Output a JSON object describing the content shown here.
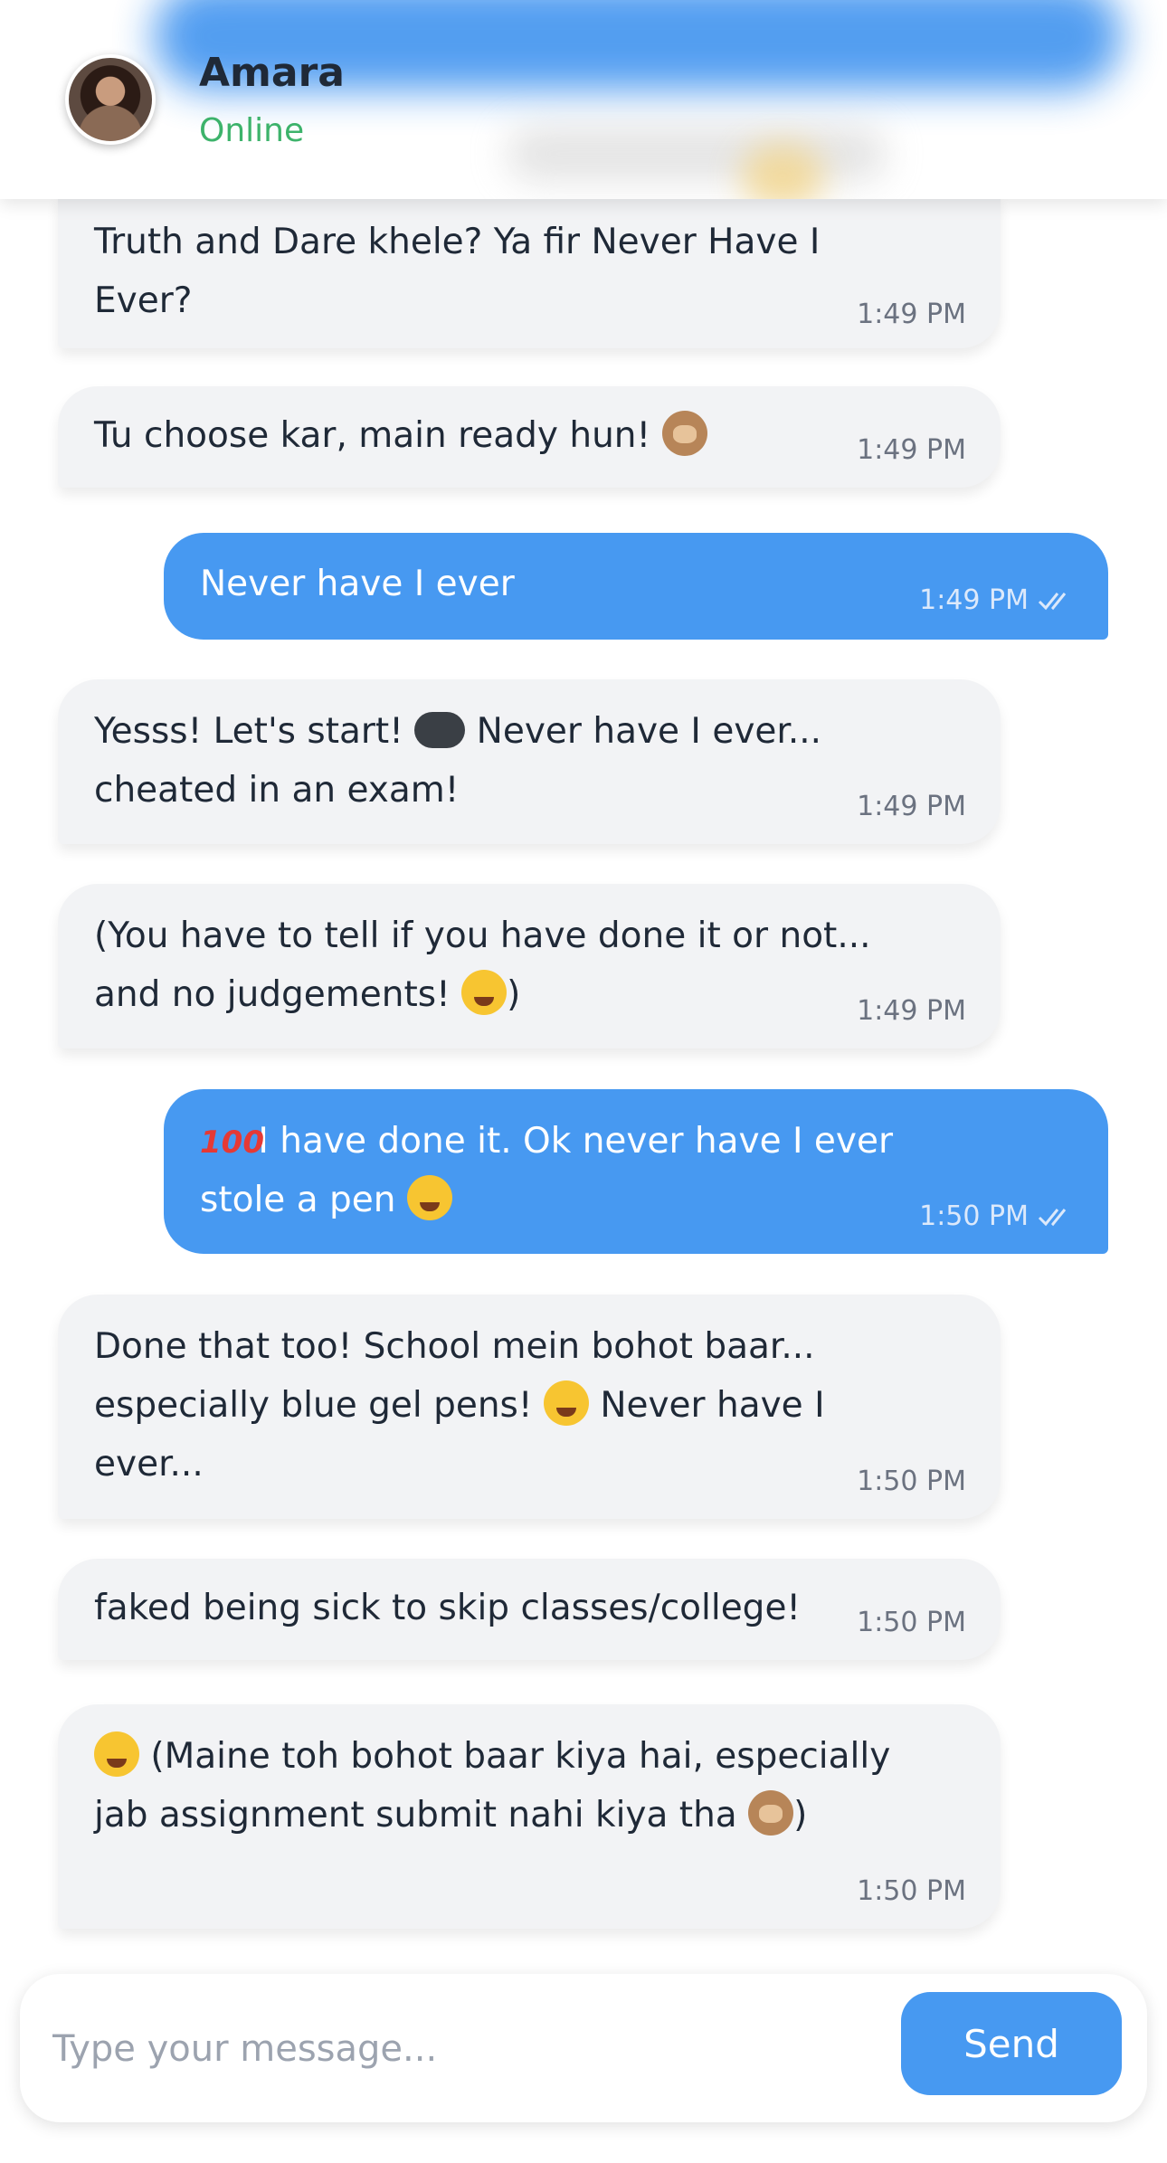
{
  "header": {
    "name": "Amara",
    "status": "Online"
  },
  "messages": [
    {
      "from": "them",
      "text": "Truth and Dare khele? Ya fir Never Have I Ever?",
      "time": "1:49 PM"
    },
    {
      "from": "them",
      "text": "Tu choose kar, main ready hun!",
      "emoji": "see-no-evil-monkey",
      "time": "1:49 PM"
    },
    {
      "from": "me",
      "text": "Never have I ever",
      "time": "1:49 PM",
      "read": true
    },
    {
      "from": "them",
      "text_a": "Yesss! Let's start!",
      "emoji": "video-game-controller",
      "text_b": "Never have I ever... cheated in an exam!",
      "time": "1:49 PM"
    },
    {
      "from": "them",
      "text_a": "(You have to tell if you have done it or not... and no judgements!",
      "emoji": "squinting-tongue-face",
      "text_b": ")",
      "time": "1:49 PM"
    },
    {
      "from": "me",
      "emoji_a": "100",
      "text_a": "I have done it. Ok never have I ever stole a pen",
      "emoji_b": "grinning-face",
      "time": "1:50 PM",
      "read": true
    },
    {
      "from": "them",
      "text_a": "Done that too! School mein bohot baar... especially blue gel pens!",
      "emoji": "tears-of-joy-face",
      "text_b": "Never have I ever...",
      "time": "1:50 PM"
    },
    {
      "from": "them",
      "text": "faked being sick to skip classes/college!",
      "time": "1:50 PM"
    },
    {
      "from": "them",
      "emoji_a": "woozy-face",
      "text_a": "(Maine toh bohot baar kiya hai, especially jab assignment submit nahi kiya tha",
      "emoji_b": "see-no-evil-monkey",
      "text_b": ")",
      "time": "1:50 PM"
    }
  ],
  "composer": {
    "placeholder": "Type your message...",
    "send_label": "Send"
  },
  "colors": {
    "accent": "#4799f1",
    "incoming_bubble": "#f2f3f5",
    "online": "#3db36b"
  }
}
